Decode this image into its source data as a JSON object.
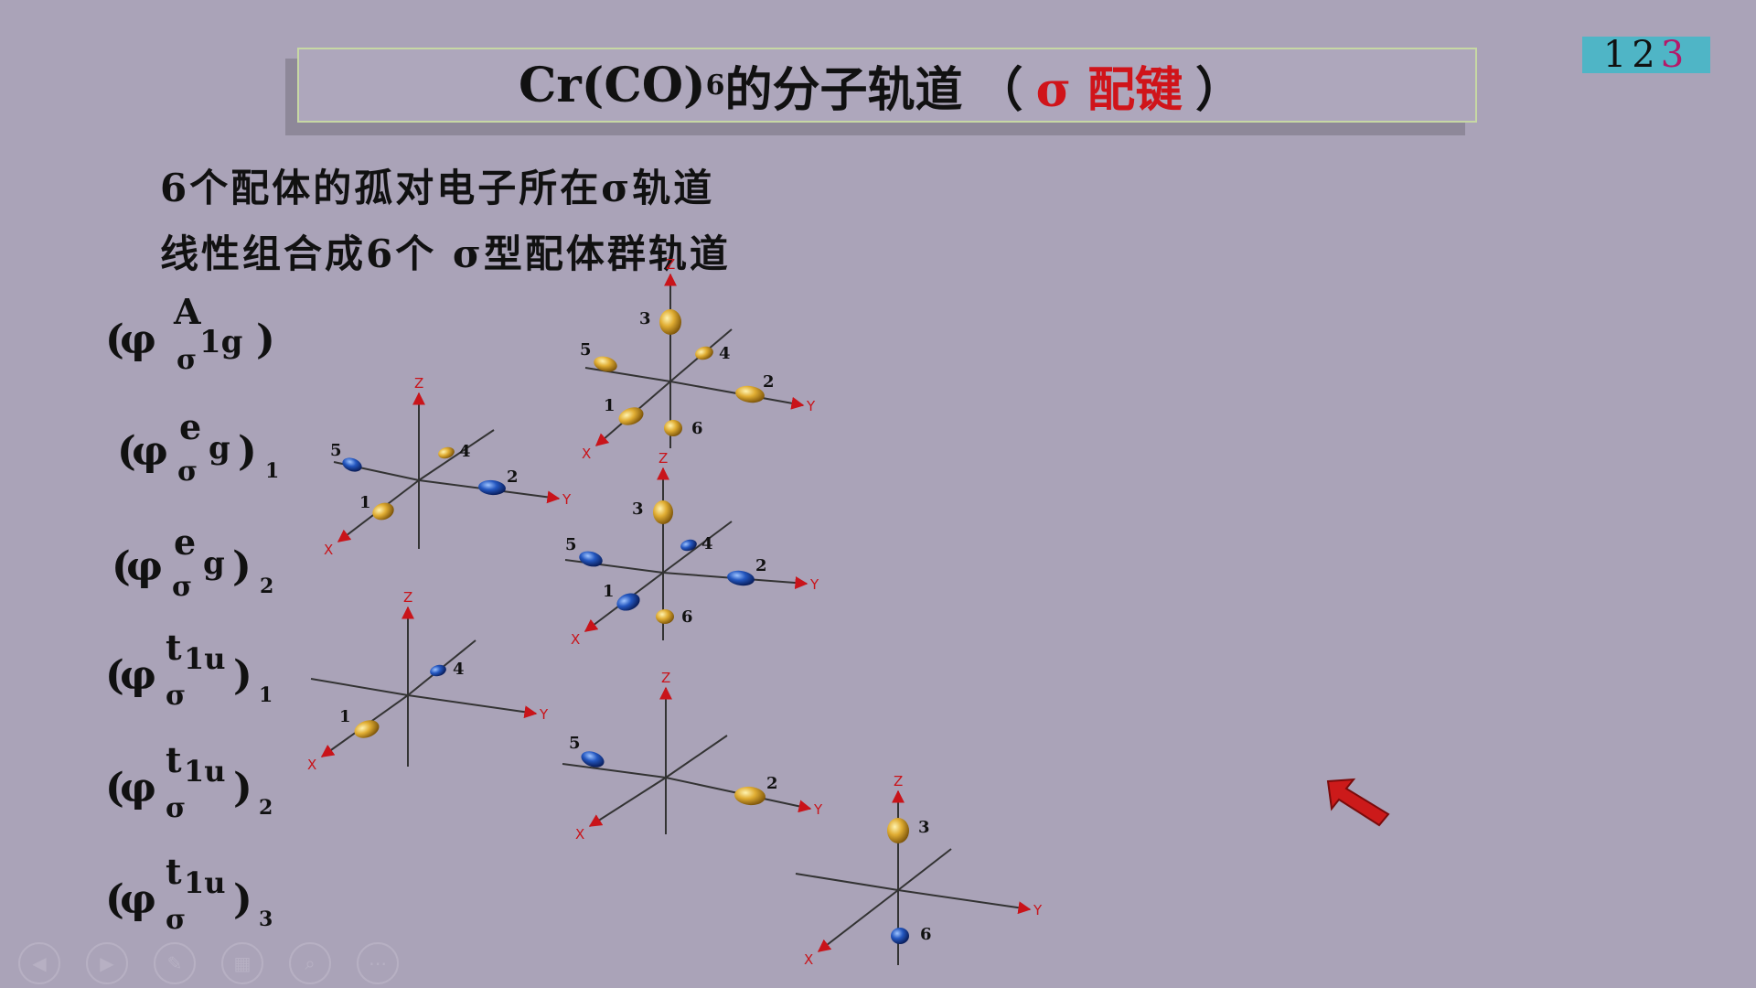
{
  "slide": {
    "title": {
      "prefix": "Cr(CO)",
      "subscript": "6",
      "suffix": "的分子轨道",
      "open_paren": "（",
      "highlight": "σ 配键",
      "close_paren": "）"
    },
    "page_indicator": {
      "p1": "1",
      "p2": "2",
      "p3": "3",
      "active": "3"
    },
    "lines": [
      "6个配体的孤对电子所在σ轨道",
      "线性组合成6个 σ型配体群轨道"
    ],
    "orbitals": [
      {
        "sup": "A",
        "subscript_right": "1g",
        "index": ""
      },
      {
        "sup": "e",
        "subscript_right": "g",
        "index": "1"
      },
      {
        "sup": "e",
        "subscript_right": "g",
        "index": "2"
      },
      {
        "sup": "t",
        "sup_index": "1u",
        "subscript_right": "",
        "index": "1"
      },
      {
        "sup": "t",
        "sup_index": "1u",
        "subscript_right": "",
        "index": "2"
      },
      {
        "sup": "t",
        "sup_index": "1u",
        "subscript_right": "",
        "index": "3"
      }
    ],
    "symbols": {
      "phi": "φ",
      "sigma": "σ",
      "open": "(",
      "close": ")"
    },
    "axis_labels": {
      "x": "X",
      "y": "Y",
      "z": "Z"
    },
    "lobe_numbers": [
      "1",
      "2",
      "3",
      "4",
      "5",
      "6"
    ],
    "colors": {
      "background": "#aaa3b8",
      "title_border": "#c7d8a4",
      "highlight": "#d0141a",
      "page_indicator_bg": "#4fb5c6",
      "active_page": "#b41a6a",
      "gold_lobe": "#d4a22c",
      "blue_lobe": "#1f4fb0",
      "axis_arrow": "#c9141a",
      "pointer": "#cc1a1a"
    },
    "toolbar_icons": [
      "back-icon",
      "play-icon",
      "pen-icon",
      "slides-icon",
      "zoom-icon",
      "more-icon"
    ]
  }
}
